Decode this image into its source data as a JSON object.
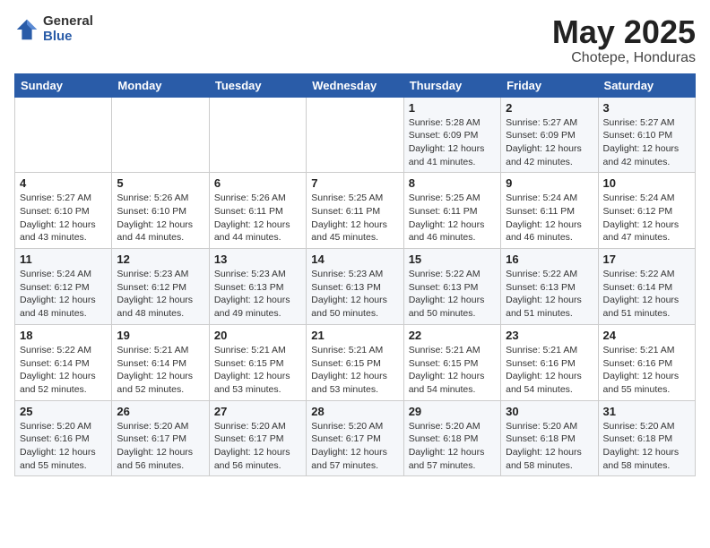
{
  "header": {
    "logo_general": "General",
    "logo_blue": "Blue",
    "title": "May 2025",
    "location": "Chotepe, Honduras"
  },
  "weekdays": [
    "Sunday",
    "Monday",
    "Tuesday",
    "Wednesday",
    "Thursday",
    "Friday",
    "Saturday"
  ],
  "weeks": [
    [
      {
        "day": "",
        "info": ""
      },
      {
        "day": "",
        "info": ""
      },
      {
        "day": "",
        "info": ""
      },
      {
        "day": "",
        "info": ""
      },
      {
        "day": "1",
        "info": "Sunrise: 5:28 AM\nSunset: 6:09 PM\nDaylight: 12 hours\nand 41 minutes."
      },
      {
        "day": "2",
        "info": "Sunrise: 5:27 AM\nSunset: 6:09 PM\nDaylight: 12 hours\nand 42 minutes."
      },
      {
        "day": "3",
        "info": "Sunrise: 5:27 AM\nSunset: 6:10 PM\nDaylight: 12 hours\nand 42 minutes."
      }
    ],
    [
      {
        "day": "4",
        "info": "Sunrise: 5:27 AM\nSunset: 6:10 PM\nDaylight: 12 hours\nand 43 minutes."
      },
      {
        "day": "5",
        "info": "Sunrise: 5:26 AM\nSunset: 6:10 PM\nDaylight: 12 hours\nand 44 minutes."
      },
      {
        "day": "6",
        "info": "Sunrise: 5:26 AM\nSunset: 6:11 PM\nDaylight: 12 hours\nand 44 minutes."
      },
      {
        "day": "7",
        "info": "Sunrise: 5:25 AM\nSunset: 6:11 PM\nDaylight: 12 hours\nand 45 minutes."
      },
      {
        "day": "8",
        "info": "Sunrise: 5:25 AM\nSunset: 6:11 PM\nDaylight: 12 hours\nand 46 minutes."
      },
      {
        "day": "9",
        "info": "Sunrise: 5:24 AM\nSunset: 6:11 PM\nDaylight: 12 hours\nand 46 minutes."
      },
      {
        "day": "10",
        "info": "Sunrise: 5:24 AM\nSunset: 6:12 PM\nDaylight: 12 hours\nand 47 minutes."
      }
    ],
    [
      {
        "day": "11",
        "info": "Sunrise: 5:24 AM\nSunset: 6:12 PM\nDaylight: 12 hours\nand 48 minutes."
      },
      {
        "day": "12",
        "info": "Sunrise: 5:23 AM\nSunset: 6:12 PM\nDaylight: 12 hours\nand 48 minutes."
      },
      {
        "day": "13",
        "info": "Sunrise: 5:23 AM\nSunset: 6:13 PM\nDaylight: 12 hours\nand 49 minutes."
      },
      {
        "day": "14",
        "info": "Sunrise: 5:23 AM\nSunset: 6:13 PM\nDaylight: 12 hours\nand 50 minutes."
      },
      {
        "day": "15",
        "info": "Sunrise: 5:22 AM\nSunset: 6:13 PM\nDaylight: 12 hours\nand 50 minutes."
      },
      {
        "day": "16",
        "info": "Sunrise: 5:22 AM\nSunset: 6:13 PM\nDaylight: 12 hours\nand 51 minutes."
      },
      {
        "day": "17",
        "info": "Sunrise: 5:22 AM\nSunset: 6:14 PM\nDaylight: 12 hours\nand 51 minutes."
      }
    ],
    [
      {
        "day": "18",
        "info": "Sunrise: 5:22 AM\nSunset: 6:14 PM\nDaylight: 12 hours\nand 52 minutes."
      },
      {
        "day": "19",
        "info": "Sunrise: 5:21 AM\nSunset: 6:14 PM\nDaylight: 12 hours\nand 52 minutes."
      },
      {
        "day": "20",
        "info": "Sunrise: 5:21 AM\nSunset: 6:15 PM\nDaylight: 12 hours\nand 53 minutes."
      },
      {
        "day": "21",
        "info": "Sunrise: 5:21 AM\nSunset: 6:15 PM\nDaylight: 12 hours\nand 53 minutes."
      },
      {
        "day": "22",
        "info": "Sunrise: 5:21 AM\nSunset: 6:15 PM\nDaylight: 12 hours\nand 54 minutes."
      },
      {
        "day": "23",
        "info": "Sunrise: 5:21 AM\nSunset: 6:16 PM\nDaylight: 12 hours\nand 54 minutes."
      },
      {
        "day": "24",
        "info": "Sunrise: 5:21 AM\nSunset: 6:16 PM\nDaylight: 12 hours\nand 55 minutes."
      }
    ],
    [
      {
        "day": "25",
        "info": "Sunrise: 5:20 AM\nSunset: 6:16 PM\nDaylight: 12 hours\nand 55 minutes."
      },
      {
        "day": "26",
        "info": "Sunrise: 5:20 AM\nSunset: 6:17 PM\nDaylight: 12 hours\nand 56 minutes."
      },
      {
        "day": "27",
        "info": "Sunrise: 5:20 AM\nSunset: 6:17 PM\nDaylight: 12 hours\nand 56 minutes."
      },
      {
        "day": "28",
        "info": "Sunrise: 5:20 AM\nSunset: 6:17 PM\nDaylight: 12 hours\nand 57 minutes."
      },
      {
        "day": "29",
        "info": "Sunrise: 5:20 AM\nSunset: 6:18 PM\nDaylight: 12 hours\nand 57 minutes."
      },
      {
        "day": "30",
        "info": "Sunrise: 5:20 AM\nSunset: 6:18 PM\nDaylight: 12 hours\nand 58 minutes."
      },
      {
        "day": "31",
        "info": "Sunrise: 5:20 AM\nSunset: 6:18 PM\nDaylight: 12 hours\nand 58 minutes."
      }
    ]
  ]
}
